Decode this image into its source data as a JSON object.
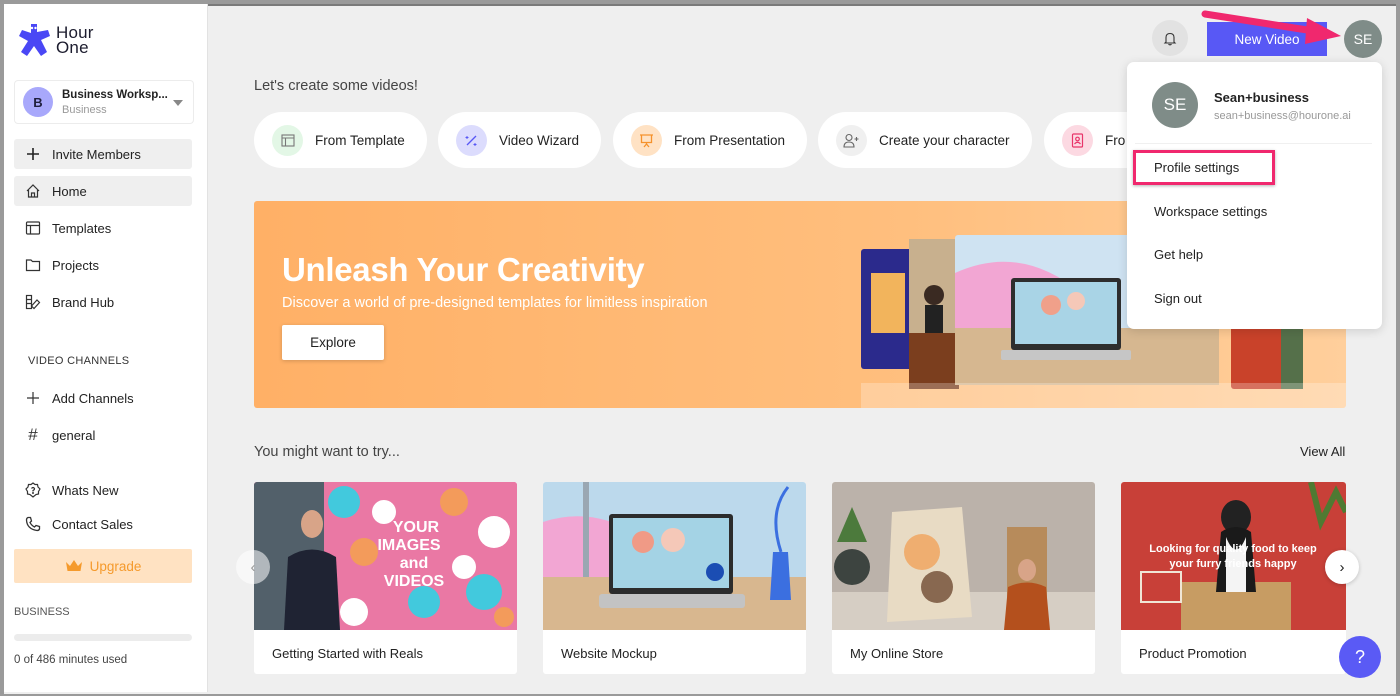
{
  "brand": {
    "name_line1": "Hour",
    "name_line2": "One",
    "accent": "#5858f5"
  },
  "workspace": {
    "avatar_letter": "B",
    "name": "Business Worksp...",
    "plan": "Business"
  },
  "sidebar": {
    "invite": {
      "label": "Invite Members",
      "icon": "plus-icon"
    },
    "items": [
      {
        "label": "Home",
        "icon": "home-icon",
        "active": true
      },
      {
        "label": "Templates",
        "icon": "templates-icon"
      },
      {
        "label": "Projects",
        "icon": "folder-icon"
      },
      {
        "label": "Brand Hub",
        "icon": "brand-hub-icon"
      }
    ],
    "channels_heading": "VIDEO CHANNELS",
    "channels": [
      {
        "label": "Add Channels",
        "icon": "plus-icon"
      },
      {
        "label": "general",
        "icon": "hash-icon"
      }
    ],
    "footer_items": [
      {
        "label": "Whats New",
        "icon": "badge-question-icon"
      },
      {
        "label": "Contact Sales",
        "icon": "phone-icon"
      }
    ],
    "upgrade_label": "Upgrade",
    "plan_label": "BUSINESS",
    "usage": {
      "used": 0,
      "total": 486,
      "text": "0 of 486 minutes used"
    }
  },
  "header": {
    "new_video_label": "New Video",
    "avatar_initials": "SE"
  },
  "main": {
    "greeting": "Let's create some videos!",
    "quick_actions": [
      {
        "label": "From Template",
        "icon": "template-icon",
        "color": "#e3f7e6"
      },
      {
        "label": "Video Wizard",
        "icon": "magic-wand-icon",
        "color": "#dcdcfd"
      },
      {
        "label": "From Presentation",
        "icon": "presentation-icon",
        "color": "#ffe2c4"
      },
      {
        "label": "Create your character",
        "icon": "add-user-icon",
        "color": "#f0f0f0"
      },
      {
        "label": "Fro",
        "icon": "portrait-icon",
        "color": "#fcd9e2"
      }
    ],
    "banner": {
      "title": "Unleash Your Creativity",
      "subtitle": "Discover a world of pre-designed templates for limitless inspiration",
      "button": "Explore"
    },
    "try_heading": "You might want to try...",
    "view_all": "View All",
    "cards": [
      {
        "title": "Getting Started with Reals",
        "overlay": "YOUR IMAGES and VIDEOS"
      },
      {
        "title": "Website Mockup",
        "overlay": ""
      },
      {
        "title": "My Online Store",
        "overlay": ""
      },
      {
        "title": "Product Promotion",
        "overlay": "Looking for quality food to keep your furry friends happy"
      }
    ],
    "help_label": "?"
  },
  "profile_menu": {
    "initials": "SE",
    "name": "Sean+business",
    "email": "sean+business@hourone.ai",
    "items": [
      "Profile settings",
      "Workspace settings",
      "Get help",
      "Sign out"
    ],
    "highlighted": "Profile settings"
  }
}
